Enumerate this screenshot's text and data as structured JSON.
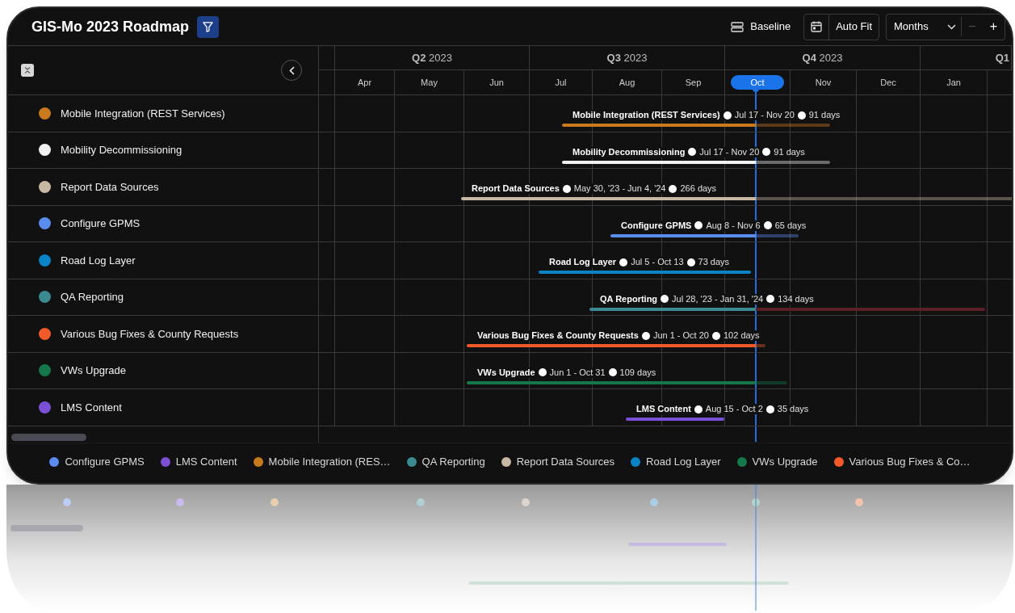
{
  "title": "GIS-Mo 2023 Roadmap",
  "toolbar": {
    "baseline": "Baseline",
    "auto_fit": "Auto Fit",
    "scale": "Months",
    "zoom_out": {
      "label": "−",
      "disabled": true
    },
    "zoom_in": {
      "label": "+",
      "disabled": false
    }
  },
  "quarters": [
    {
      "label": "**Q2** 2023"
    },
    {
      "label": "**Q3** 2023"
    },
    {
      "label": "**Q4** 2023"
    },
    {
      "label": "**Q1**"
    }
  ],
  "months": [
    {
      "label": "Apr",
      "selected": false
    },
    {
      "label": "May",
      "selected": false
    },
    {
      "label": "Jun",
      "selected": false
    },
    {
      "label": "Jul",
      "selected": false
    },
    {
      "label": "Aug",
      "selected": false
    },
    {
      "label": "Sep",
      "selected": false
    },
    {
      "label": "Oct",
      "selected": true
    },
    {
      "label": "Nov",
      "selected": false
    },
    {
      "label": "Dec",
      "selected": false
    },
    {
      "label": "Jan",
      "selected": false
    }
  ],
  "tasks": [
    {
      "name": "Mobile Integration (REST Services)",
      "bar_label": "Mobile Integration (REST Services)",
      "color": "#c97a1e",
      "range": "Jul 17 - Nov 20",
      "duration": "91 days"
    },
    {
      "name": "Mobility Decommissioning",
      "bar_label": "Mobility Decommissioning",
      "color": "#f2f2f2",
      "range": "Jul 17 - Nov 20",
      "duration": "91 days"
    },
    {
      "name": "Report Data Sources",
      "bar_label": "Report Data Sources",
      "color": "#c8b8a4",
      "range": "May 30, '23 - Jun 4, '24",
      "duration": "266 days"
    },
    {
      "name": "Configure GPMS",
      "bar_label": "Configure GPMS",
      "color": "#5b8def",
      "range": "Aug 8 - Nov 6",
      "duration": "65 days"
    },
    {
      "name": "Road Log Layer",
      "bar_label": "Road Log Layer",
      "color": "#0a84c6",
      "range": "Jul 5 - Oct 13",
      "duration": "73 days"
    },
    {
      "name": "QA Reporting",
      "bar_label": "QA Reporting",
      "color": "#3a8a92",
      "tail": {
        "color": "#5c1f2a"
      },
      "range": "Jul 28, '23 - Jan 31, '24",
      "duration": "134 days"
    },
    {
      "name": "Various Bug Fixes & County Requests",
      "bar_label": "Various Bug Fixes & County Requests",
      "color": "#f25a2a",
      "range": "Jun 1 - Oct 20",
      "duration": "102 days"
    },
    {
      "name": "VWs Upgrade",
      "bar_label": "VWs Upgrade",
      "color": "#15784a",
      "range": "Jun 1 - Oct 31",
      "duration": "109 days"
    },
    {
      "name": "LMS Content",
      "bar_label": "LMS Content",
      "color": "#7b4fd6",
      "range": "Aug 15 - Oct 2",
      "duration": "35 days"
    }
  ],
  "legend": [
    {
      "label": "Configure GPMS",
      "color": "#5b8def"
    },
    {
      "label": "LMS Content",
      "color": "#7b4fd6"
    },
    {
      "label": "Mobile Integration (RES…",
      "color": "#c97a1e"
    },
    {
      "label": "QA Reporting",
      "color": "#3a8a92"
    },
    {
      "label": "Report Data Sources",
      "color": "#c8b8a4"
    },
    {
      "label": "Road Log Layer",
      "color": "#0a84c6"
    },
    {
      "label": "VWs Upgrade",
      "color": "#15784a"
    },
    {
      "label": "Various Bug Fixes & Co…",
      "color": "#f25a2a"
    }
  ]
}
